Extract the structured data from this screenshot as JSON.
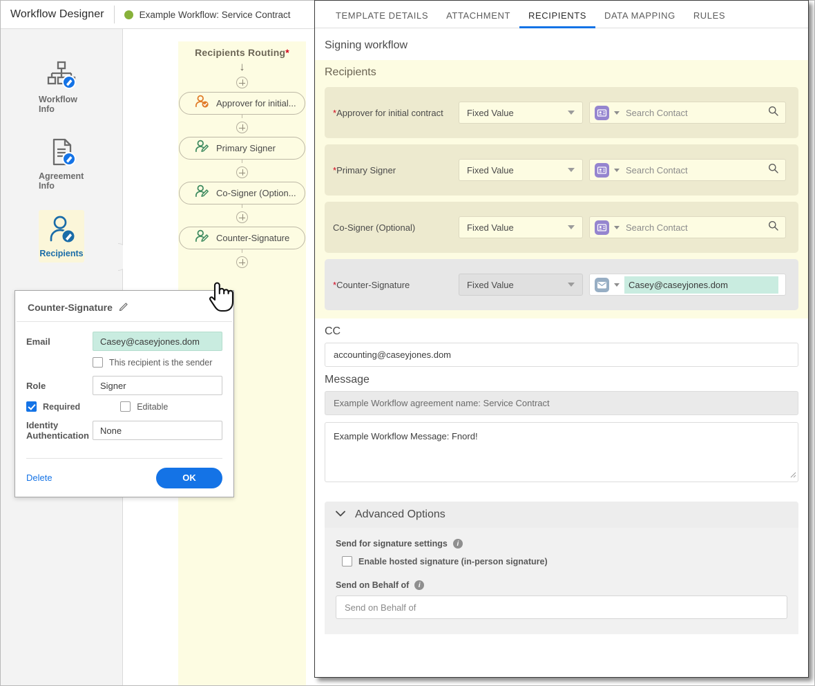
{
  "topbar": {
    "app_title": "Workflow Designer",
    "workflow_name": "Example Workflow: Service Contract",
    "status_color": "#87b13a"
  },
  "sidebar": {
    "items": [
      {
        "label": "Workflow Info",
        "icon": "workflow-info-icon",
        "active": false
      },
      {
        "label": "Agreement Info",
        "icon": "agreement-info-icon",
        "active": false
      },
      {
        "label": "Recipients",
        "icon": "recipients-icon",
        "active": true
      },
      {
        "label": "",
        "icon": "briefcase-icon",
        "active": false
      }
    ]
  },
  "canvas": {
    "routing_title": "Recipients Routing",
    "routing_required_mark": "*",
    "nodes": [
      {
        "label": "Approver for initial...",
        "icon": "approver-person-check-icon",
        "color": "#e07b28"
      },
      {
        "label": "Primary Signer",
        "icon": "signer-person-pen-icon",
        "color": "#3d8a5f"
      },
      {
        "label": "Co-Signer (Option...",
        "icon": "signer-person-pen-icon",
        "color": "#3d8a5f"
      },
      {
        "label": "Counter-Signature",
        "icon": "signer-person-pen-icon",
        "color": "#3d8a5f"
      }
    ]
  },
  "popup": {
    "title": "Counter-Signature",
    "email_label": "Email",
    "email_value": "Casey@caseyjones.dom",
    "sender_checkbox_label": "This recipient is the sender",
    "sender_checked": false,
    "role_label": "Role",
    "role_value": "Signer",
    "required_label": "Required",
    "required_checked": true,
    "editable_label": "Editable",
    "editable_checked": false,
    "identity_label": "Identity Authentication",
    "identity_value": "None",
    "delete_label": "Delete",
    "ok_label": "OK"
  },
  "right_panel": {
    "tabs": [
      {
        "label": "TEMPLATE DETAILS",
        "active": false
      },
      {
        "label": "ATTACHMENT",
        "active": false
      },
      {
        "label": "RECIPIENTS",
        "active": true
      },
      {
        "label": "DATA MAPPING",
        "active": false
      },
      {
        "label": "RULES",
        "active": false
      }
    ],
    "signing_workflow_title": "Signing workflow",
    "recipients_title": "Recipients",
    "recipients": [
      {
        "label": "Approver for initial contract",
        "required": true,
        "value_type": "Fixed Value",
        "contact_icon": "contact-card-icon",
        "contact_placeholder": "Search Contact",
        "contact_value": "",
        "selected": false
      },
      {
        "label": "Primary Signer",
        "required": true,
        "value_type": "Fixed Value",
        "contact_icon": "contact-card-icon",
        "contact_placeholder": "Search Contact",
        "contact_value": "",
        "selected": false
      },
      {
        "label": "Co-Signer (Optional)",
        "required": false,
        "value_type": "Fixed Value",
        "contact_icon": "contact-card-icon",
        "contact_placeholder": "Search Contact",
        "contact_value": "",
        "selected": false
      },
      {
        "label": "Counter-Signature",
        "required": true,
        "value_type": "Fixed Value",
        "contact_icon": "email-envelope-icon",
        "contact_placeholder": "",
        "contact_value": "Casey@caseyjones.dom",
        "selected": true
      }
    ],
    "cc_label": "CC",
    "cc_value": "accounting@caseyjones.dom",
    "message_label": "Message",
    "agreement_name_value": "Example Workflow agreement name: Service Contract",
    "message_value": "Example Workflow Message: Fnord!",
    "advanced_options_label": "Advanced Options",
    "send_for_signature_label": "Send for signature settings",
    "hosted_signature_label": "Enable hosted signature (in-person signature)",
    "hosted_signature_checked": false,
    "send_on_behalf_label": "Send on Behalf of",
    "send_on_behalf_placeholder": "Send on Behalf of"
  },
  "colors": {
    "accent_blue": "#1473e6",
    "routing_bg": "#fdfce2",
    "recipient_row_bg": "#edeacf",
    "highlight_green": "#c9ece0",
    "status_green": "#87b13a"
  }
}
